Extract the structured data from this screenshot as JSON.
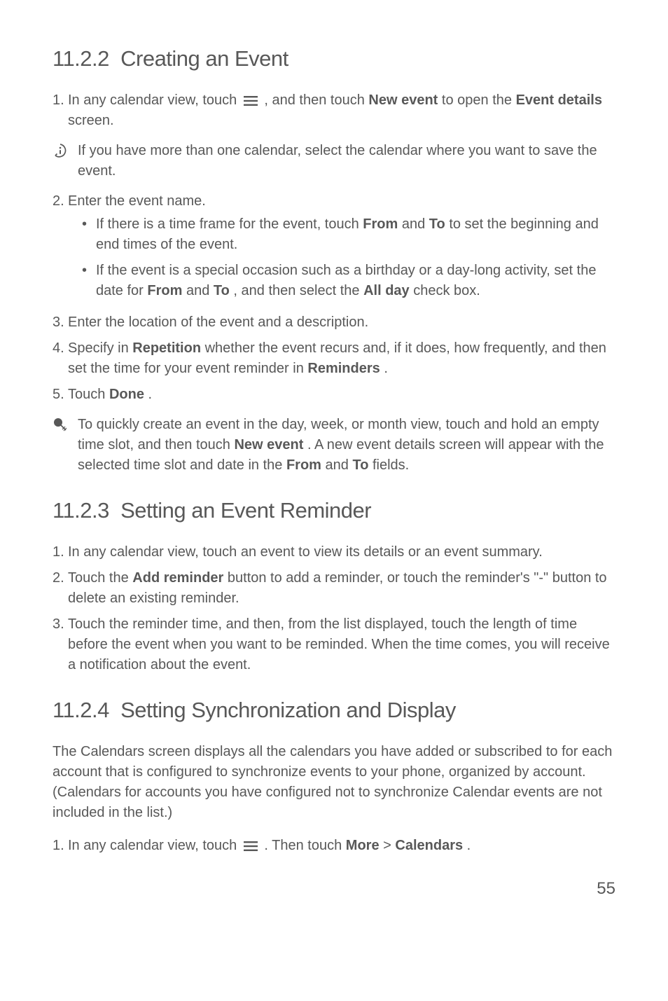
{
  "section1": {
    "heading": "11.2.2  Creating an Event",
    "step1": {
      "num": "1.",
      "p1a": "In any calendar view, touch ",
      "p1b": " , and then touch ",
      "bold1": "New event",
      "p1c": " to open the ",
      "bold2": "Event details",
      "p1d": " screen."
    },
    "note1": "If you have more than one calendar, select the calendar where you want to save the event.",
    "step2": {
      "num": "2.",
      "text": "Enter the event name.",
      "b1a": "If there is a time frame for the event, touch ",
      "b1_from": "From",
      "b1b": " and ",
      "b1_to": "To",
      "b1c": " to set the beginning and end times of the event.",
      "b2a": "If the event is a special occasion such as a birthday or a day-long activity, set the date for ",
      "b2_from": "From",
      "b2b": " and ",
      "b2_to": "To",
      "b2c": ", and then select the ",
      "b2_allday": "All day",
      "b2d": " check box."
    },
    "step3": {
      "num": "3.",
      "text": "Enter the location of the event and a description."
    },
    "step4": {
      "num": "4.",
      "a": "Specify in ",
      "rep": "Repetition",
      "b": " whether the event recurs and, if it does, how frequently, and then set the time for your event reminder in ",
      "rem": "Reminders",
      "c": "."
    },
    "step5": {
      "num": "5.",
      "a": "Touch ",
      "done": "Done",
      "b": "."
    },
    "tip": {
      "a": "To quickly create an event in the day, week, or month view, touch and hold an empty time slot, and then touch ",
      "newev": "New event",
      "b": ". A new event details screen will appear with the selected time slot and date in the ",
      "from": "From",
      "c": " and ",
      "to": "To",
      "d": " fields."
    }
  },
  "section2": {
    "heading": "11.2.3  Setting an Event Reminder",
    "step1": {
      "num": "1.",
      "text": "In any calendar view, touch an event to view its details or an event summary."
    },
    "step2": {
      "num": "2.",
      "a": "Touch the ",
      "addrem": "Add reminder",
      "b": " button to add a reminder, or touch the reminder's \"-\" button to delete an existing reminder."
    },
    "step3": {
      "num": "3.",
      "text": "Touch the reminder time, and then, from the list displayed, touch the length of time before the event when you want to be reminded. When the time comes, you will receive a notification about the event."
    }
  },
  "section3": {
    "heading": "11.2.4  Setting Synchronization and Display",
    "para": "The Calendars screen displays all the calendars you have added or subscribed to for each account that is configured to synchronize events to your phone, organized by account. (Calendars for accounts you have configured not to synchronize Calendar events are not included in the list.)",
    "step1": {
      "num": "1.",
      "a": "In any calendar view, touch ",
      "b": " . Then touch ",
      "more": "More",
      "c": " > ",
      "cal": "Calendars",
      "d": "."
    }
  },
  "pagenum": "55"
}
